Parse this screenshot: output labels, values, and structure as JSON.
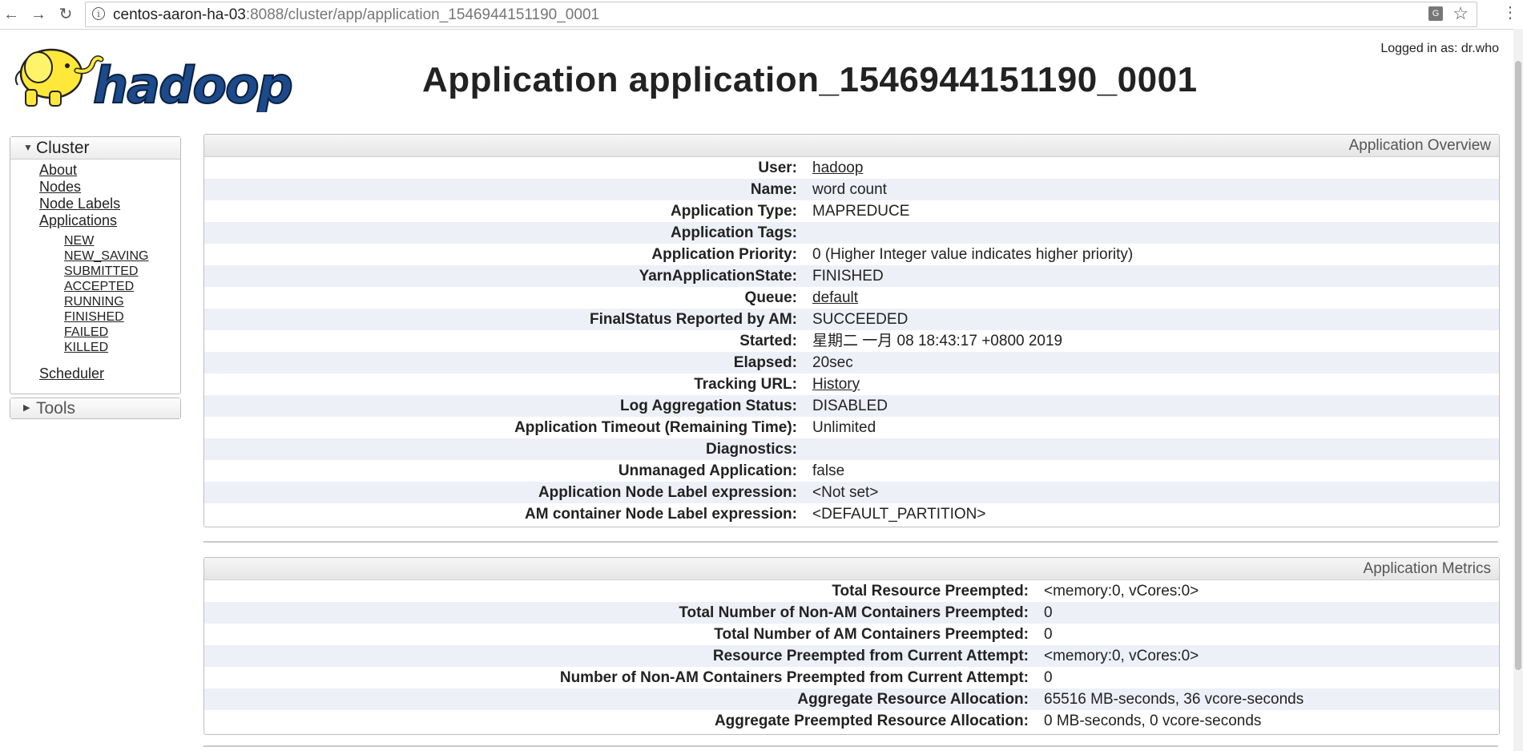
{
  "browser": {
    "url_host": "centos-aaron-ha-03",
    "url_rest": ":8088/cluster/app/application_1546944151190_0001"
  },
  "header": {
    "logo_text": "hadoop",
    "title": "Application application_1546944151190_0001",
    "logged_in": "Logged in as: dr.who"
  },
  "sidebar": {
    "cluster_label": "Cluster",
    "links": [
      "About",
      "Nodes",
      "Node Labels",
      "Applications"
    ],
    "app_states": [
      "NEW",
      "NEW_SAVING",
      "SUBMITTED",
      "ACCEPTED",
      "RUNNING",
      "FINISHED",
      "FAILED",
      "KILLED"
    ],
    "scheduler": "Scheduler",
    "tools_label": "Tools"
  },
  "overview": {
    "heading": "Application Overview",
    "rows": [
      {
        "label": "User:",
        "value": "hadoop",
        "link": true
      },
      {
        "label": "Name:",
        "value": "word count"
      },
      {
        "label": "Application Type:",
        "value": "MAPREDUCE"
      },
      {
        "label": "Application Tags:",
        "value": ""
      },
      {
        "label": "Application Priority:",
        "value": "0 (Higher Integer value indicates higher priority)"
      },
      {
        "label": "YarnApplicationState:",
        "value": "FINISHED"
      },
      {
        "label": "Queue:",
        "value": "default",
        "link": true
      },
      {
        "label": "FinalStatus Reported by AM:",
        "value": "SUCCEEDED"
      },
      {
        "label": "Started:",
        "value": "星期二 一月 08 18:43:17 +0800 2019"
      },
      {
        "label": "Elapsed:",
        "value": "20sec"
      },
      {
        "label": "Tracking URL:",
        "value": "History",
        "link": true
      },
      {
        "label": "Log Aggregation Status:",
        "value": "DISABLED"
      },
      {
        "label": "Application Timeout (Remaining Time):",
        "value": "Unlimited"
      },
      {
        "label": "Diagnostics:",
        "value": ""
      },
      {
        "label": "Unmanaged Application:",
        "value": "false"
      },
      {
        "label": "Application Node Label expression:",
        "value": "<Not set>"
      },
      {
        "label": "AM container Node Label expression:",
        "value": "<DEFAULT_PARTITION>"
      }
    ]
  },
  "metrics": {
    "heading": "Application Metrics",
    "rows": [
      {
        "label": "Total Resource Preempted:",
        "value": "<memory:0, vCores:0>"
      },
      {
        "label": "Total Number of Non-AM Containers Preempted:",
        "value": "0"
      },
      {
        "label": "Total Number of AM Containers Preempted:",
        "value": "0"
      },
      {
        "label": "Resource Preempted from Current Attempt:",
        "value": "<memory:0, vCores:0>"
      },
      {
        "label": "Number of Non-AM Containers Preempted from Current Attempt:",
        "value": "0"
      },
      {
        "label": "Aggregate Resource Allocation:",
        "value": "65516 MB-seconds, 36 vcore-seconds"
      },
      {
        "label": "Aggregate Preempted Resource Allocation:",
        "value": "0 MB-seconds, 0 vcore-seconds"
      }
    ]
  }
}
